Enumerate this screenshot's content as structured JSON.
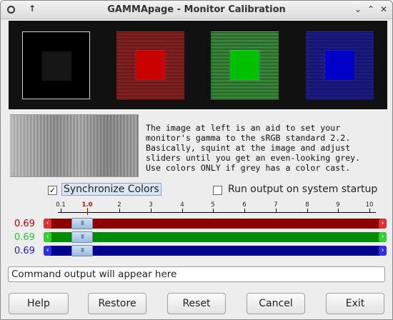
{
  "window": {
    "title": "GAMMApage - Monitor Calibration"
  },
  "info_text": "The image at left is an aid to set your\nmonitor's gamma to the sRGB standard 2.2.\nBasically, squint at the image and adjust\nsliders until you get an even-looking grey.\nUse colors ONLY if grey has a color cast.",
  "options": {
    "sync_label": "Synchronize Colors",
    "sync_checked": true,
    "run_label": "Run output on system startup",
    "run_checked": false
  },
  "ruler": {
    "ticks": [
      "0.1",
      "1.0",
      "2",
      "3",
      "4",
      "5",
      "6",
      "7",
      "8",
      "9",
      "10"
    ],
    "current_label": "1.0"
  },
  "sliders": [
    {
      "name": "red",
      "value": "0.69",
      "color": "#8b0000",
      "text_color": "#c00000",
      "arrow_color": "#e03030"
    },
    {
      "name": "green",
      "value": "0.69",
      "color": "#008b00",
      "text_color": "#22cc22",
      "arrow_color": "#30d030"
    },
    {
      "name": "blue",
      "value": "0.69",
      "color": "#00008b",
      "text_color": "#1a1acc",
      "arrow_color": "#3030e0"
    }
  ],
  "output": {
    "text": "Command output will appear here"
  },
  "buttons": {
    "help": "Help",
    "restore": "Restore",
    "reset": "Reset",
    "cancel": "Cancel",
    "exit": "Exit"
  },
  "glyphs": {
    "thumb_grip": "III",
    "arrow_left": "‹",
    "arrow_right": "›",
    "check": "✓"
  }
}
